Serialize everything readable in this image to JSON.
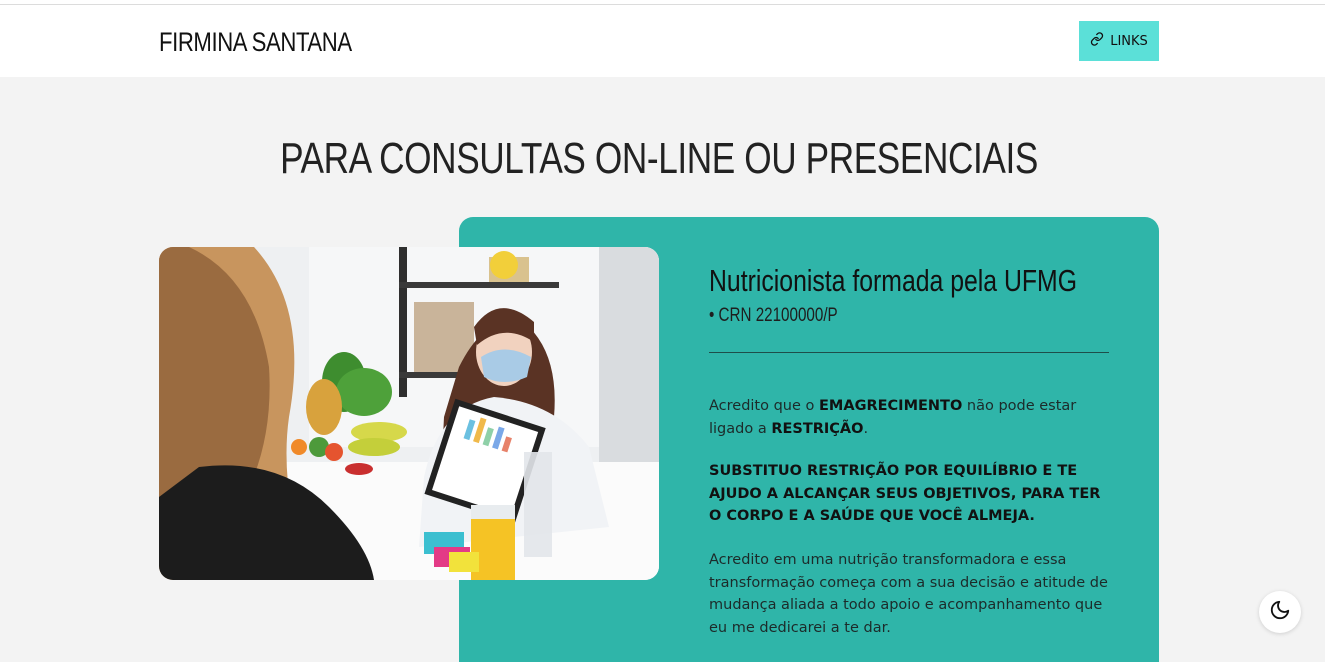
{
  "header": {
    "brand": "FIRMINA SANTANA",
    "links_label": "LINKS"
  },
  "section": {
    "title": "PARA CONSULTAS ON-LINE OU PRESENCIAIS"
  },
  "profile": {
    "headline": "Nutricionista formada pela UFMG",
    "crn": "• CRN 22100000/P",
    "p1_a": "Acredito que o ",
    "p1_b": "EMAGRECIMENTO",
    "p1_c": " não pode estar ligado a ",
    "p1_d": "RESTRIÇÃO",
    "p1_e": ".",
    "p2": "SUBSTITUO RESTRIÇÃO POR EQUILÍBRIO E TE AJUDO A ALCANÇAR SEUS OBJETIVOS, PARA TER O CORPO E A SAÚDE QUE VOCÊ ALMEJA.",
    "p3": "Acredito em uma nutrição transformadora e essa transformação começa com a sua decisão e atitude de mudança aliada a todo apoio e acompanhamento que eu me dedicarei a te dar."
  },
  "icons": {
    "links": "link-icon",
    "theme_toggle": "moon-icon"
  },
  "colors": {
    "accent": "#2fb5a9",
    "button": "#5be0d8",
    "background": "#f3f3f3"
  }
}
